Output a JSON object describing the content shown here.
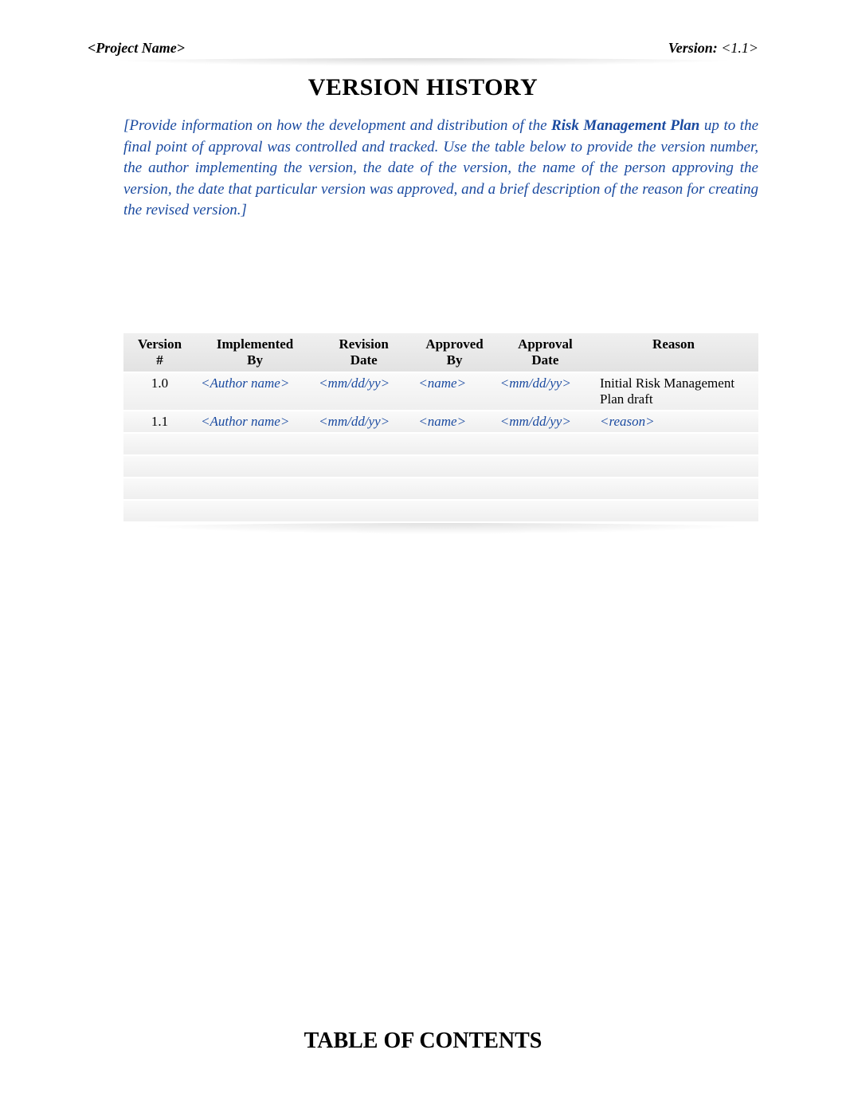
{
  "header": {
    "project_name": "<Project Name>",
    "version_label": "Version:",
    "version_value": "<1.1>"
  },
  "title": "VERSION HISTORY",
  "instruction": {
    "part1": "[Provide information on how the development and distribution of the ",
    "bold": "Risk Management Plan",
    "part2": " up to the final point of approval was controlled and tracked.  Use the table below to provide the version number, the author implementing the version, the date of the version, the name of the person approving the version, the date ",
    "part3": "that particular version was approved, and a brief description of the reason for creating the revised version.]"
  },
  "table": {
    "headers": {
      "version": "Version\n#",
      "implemented_by": "Implemented\nBy",
      "revision_date": "Revision\nDate",
      "approved_by": "Approved\nBy",
      "approval_date": "Approval\nDate",
      "reason": "Reason"
    },
    "rows": [
      {
        "version": "1.0",
        "implemented_by": "<Author name>",
        "revision_date": "<mm/dd/yy>",
        "approved_by": "<name>",
        "approval_date": "<mm/dd/yy>",
        "reason": "Initial Risk Management Plan draft",
        "reason_is_placeholder": false
      },
      {
        "version": "1.1",
        "implemented_by": "<Author name>",
        "revision_date": "<mm/dd/yy>",
        "approved_by": "<name>",
        "approval_date": "<mm/dd/yy>",
        "reason": "<reason>",
        "reason_is_placeholder": true
      }
    ],
    "empty_rows": 4
  },
  "toc_title": "TABLE OF CONTENTS"
}
